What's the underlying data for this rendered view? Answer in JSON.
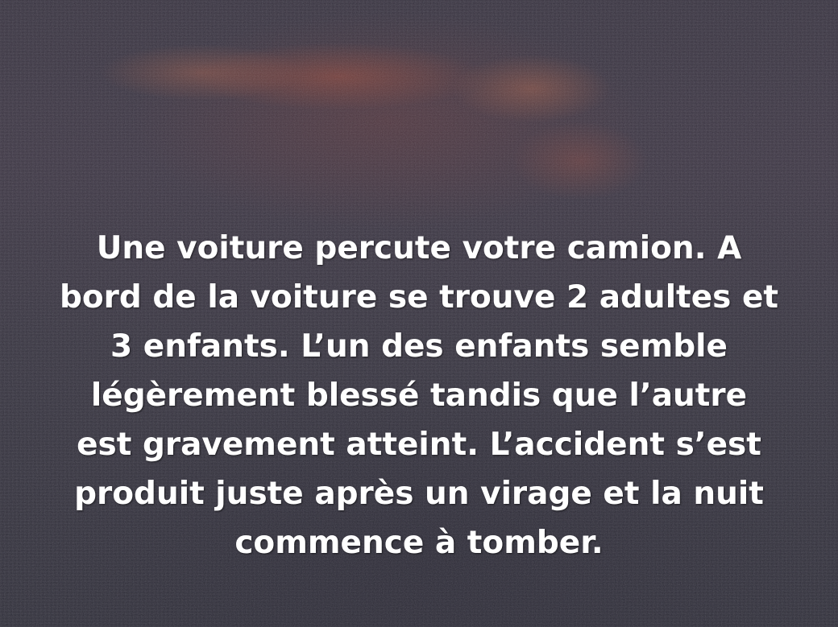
{
  "slide": {
    "lines": [
      "Une voiture percute votre camion. A",
      "bord de la voiture se trouve 2 adultes et",
      "3 enfants. L’un des enfants semble",
      "légèrement blessé tandis que l’autre",
      "est gravement atteint. L’accident s’est",
      "produit juste après un virage et la nuit",
      "commence à tomber."
    ]
  },
  "colors": {
    "text": "#ffffff",
    "background": "#2e2c3a",
    "glow": "#96463a"
  }
}
